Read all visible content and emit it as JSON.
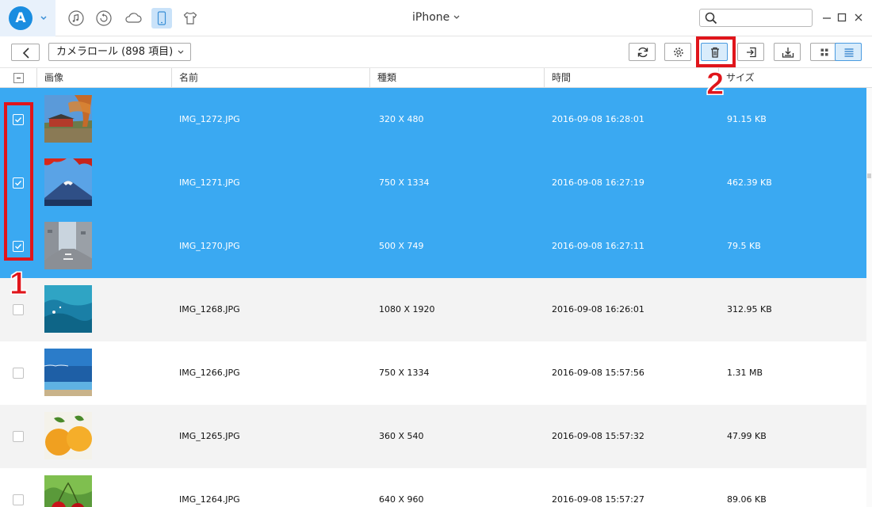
{
  "app": {
    "logo_letter": "A",
    "device_name": "iPhone"
  },
  "title_icons": [
    "music-icon",
    "backup-icon",
    "icloud-icon",
    "phone-icon",
    "tshirt-icon"
  ],
  "search": {
    "placeholder": "",
    "value": ""
  },
  "toolbar": {
    "album_label": "カメラロール (898 項目)",
    "buttons": [
      "refresh-icon",
      "settings-icon",
      "trash-icon",
      "import-icon",
      "export-icon",
      "grid-view-icon",
      "list-view-icon"
    ]
  },
  "annotations": {
    "step1": "1",
    "step2": "2"
  },
  "table": {
    "headers": {
      "image": "画像",
      "name": "名前",
      "type": "種類",
      "time": "時間",
      "size": "サイズ"
    },
    "rows": [
      {
        "selected": true,
        "name": "IMG_1272.JPG",
        "type": "320 X 480",
        "time": "2016-09-08 16:28:01",
        "size": "91.15 KB"
      },
      {
        "selected": true,
        "name": "IMG_1271.JPG",
        "type": "750 X 1334",
        "time": "2016-09-08 16:27:19",
        "size": "462.39 KB"
      },
      {
        "selected": true,
        "name": "IMG_1270.JPG",
        "type": "500 X 749",
        "time": "2016-09-08 16:27:11",
        "size": "79.5 KB"
      },
      {
        "selected": false,
        "name": "IMG_1268.JPG",
        "type": "1080 X 1920",
        "time": "2016-09-08 16:26:01",
        "size": "312.95 KB"
      },
      {
        "selected": false,
        "name": "IMG_1266.JPG",
        "type": "750 X 1334",
        "time": "2016-09-08 15:57:56",
        "size": "1.31 MB"
      },
      {
        "selected": false,
        "name": "IMG_1265.JPG",
        "type": "360 X 540",
        "time": "2016-09-08 15:57:32",
        "size": "47.99 KB"
      },
      {
        "selected": false,
        "name": "IMG_1264.JPG",
        "type": "640 X 960",
        "time": "2016-09-08 15:57:27",
        "size": "89.06 KB"
      }
    ]
  },
  "colors": {
    "accent": "#3aa9f2",
    "annotation": "#e0151b",
    "active_tab": "#c9e2f9"
  }
}
